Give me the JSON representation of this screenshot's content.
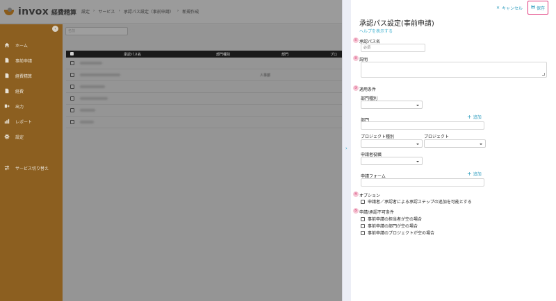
{
  "app": {
    "brand": "invox",
    "brand_sub": "経費精算"
  },
  "breadcrumb": [
    "設定",
    "サービス",
    "承認パス設定（事前申請）",
    "新規作成"
  ],
  "sidebar": {
    "collapse_icon": "chevron-left-icon",
    "items": [
      {
        "label": "ホーム",
        "icon": "home-icon"
      },
      {
        "label": "事前申請",
        "icon": "document-icon"
      },
      {
        "label": "経費精算",
        "icon": "document-icon"
      },
      {
        "label": "経費",
        "icon": "document-icon"
      },
      {
        "label": "出力",
        "icon": "export-icon"
      },
      {
        "label": "レポート",
        "icon": "chart-icon"
      },
      {
        "label": "設定",
        "icon": "gear-icon"
      },
      {
        "label": "サービス切り替え",
        "icon": "switch-icon"
      }
    ]
  },
  "list": {
    "filter_placeholder": "名前",
    "columns": [
      "承認パス名",
      "部門種別",
      "部門",
      "プロ"
    ],
    "rows": [
      {
        "dept": ""
      },
      {
        "dept": "人事部"
      },
      {
        "dept": ""
      },
      {
        "dept": ""
      },
      {
        "dept": ""
      },
      {
        "dept": ""
      }
    ]
  },
  "panel": {
    "cancel_label": "キャンセル",
    "save_label": "保存",
    "title": "承認パス設定(事前申請)",
    "help_link": "ヘルプを表示する",
    "steps": [
      "①",
      "②",
      "③",
      "④",
      "⑤"
    ],
    "path_name_label": "承認パス名",
    "path_name_placeholder": "必須",
    "description_label": "説明",
    "conditions_label": "適用条件",
    "dept_type_label": "部門種別",
    "dept_label": "部門",
    "add_label": "追加",
    "project_type_label": "プロジェクト種別",
    "project_label": "プロジェクト",
    "applicant_role_label": "申請者役職",
    "form_label": "申請フォーム",
    "options_label": "オプション",
    "option_items": [
      "申請者／承認者による承認ステップの追加を可能とする"
    ],
    "disallow_label": "申請/承認不可条件",
    "disallow_items": [
      "事前申請の担当者が空の場合",
      "事前申請の部門が空の場合",
      "事前申請のプロジェクトが空の場合"
    ]
  },
  "colors": {
    "sidebar_bg": "#8c5f20",
    "accent": "#2a9bbd",
    "save_highlight": "#e0357a",
    "step_badge": "#f6c8d6"
  }
}
